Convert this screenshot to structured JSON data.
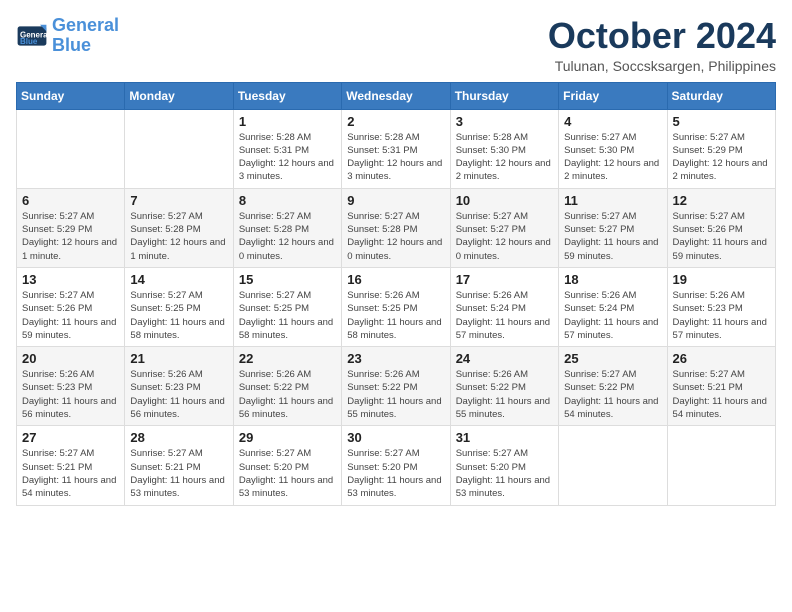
{
  "logo": {
    "line1": "General",
    "line2": "Blue"
  },
  "title": "October 2024",
  "location": "Tulunan, Soccsksargen, Philippines",
  "weekdays": [
    "Sunday",
    "Monday",
    "Tuesday",
    "Wednesday",
    "Thursday",
    "Friday",
    "Saturday"
  ],
  "weeks": [
    [
      null,
      null,
      {
        "day": 1,
        "sunrise": "5:28 AM",
        "sunset": "5:31 PM",
        "daylight": "12 hours and 3 minutes."
      },
      {
        "day": 2,
        "sunrise": "5:28 AM",
        "sunset": "5:31 PM",
        "daylight": "12 hours and 3 minutes."
      },
      {
        "day": 3,
        "sunrise": "5:28 AM",
        "sunset": "5:30 PM",
        "daylight": "12 hours and 2 minutes."
      },
      {
        "day": 4,
        "sunrise": "5:27 AM",
        "sunset": "5:30 PM",
        "daylight": "12 hours and 2 minutes."
      },
      {
        "day": 5,
        "sunrise": "5:27 AM",
        "sunset": "5:29 PM",
        "daylight": "12 hours and 2 minutes."
      }
    ],
    [
      {
        "day": 6,
        "sunrise": "5:27 AM",
        "sunset": "5:29 PM",
        "daylight": "12 hours and 1 minute."
      },
      {
        "day": 7,
        "sunrise": "5:27 AM",
        "sunset": "5:28 PM",
        "daylight": "12 hours and 1 minute."
      },
      {
        "day": 8,
        "sunrise": "5:27 AM",
        "sunset": "5:28 PM",
        "daylight": "12 hours and 0 minutes."
      },
      {
        "day": 9,
        "sunrise": "5:27 AM",
        "sunset": "5:28 PM",
        "daylight": "12 hours and 0 minutes."
      },
      {
        "day": 10,
        "sunrise": "5:27 AM",
        "sunset": "5:27 PM",
        "daylight": "12 hours and 0 minutes."
      },
      {
        "day": 11,
        "sunrise": "5:27 AM",
        "sunset": "5:27 PM",
        "daylight": "11 hours and 59 minutes."
      },
      {
        "day": 12,
        "sunrise": "5:27 AM",
        "sunset": "5:26 PM",
        "daylight": "11 hours and 59 minutes."
      }
    ],
    [
      {
        "day": 13,
        "sunrise": "5:27 AM",
        "sunset": "5:26 PM",
        "daylight": "11 hours and 59 minutes."
      },
      {
        "day": 14,
        "sunrise": "5:27 AM",
        "sunset": "5:25 PM",
        "daylight": "11 hours and 58 minutes."
      },
      {
        "day": 15,
        "sunrise": "5:27 AM",
        "sunset": "5:25 PM",
        "daylight": "11 hours and 58 minutes."
      },
      {
        "day": 16,
        "sunrise": "5:26 AM",
        "sunset": "5:25 PM",
        "daylight": "11 hours and 58 minutes."
      },
      {
        "day": 17,
        "sunrise": "5:26 AM",
        "sunset": "5:24 PM",
        "daylight": "11 hours and 57 minutes."
      },
      {
        "day": 18,
        "sunrise": "5:26 AM",
        "sunset": "5:24 PM",
        "daylight": "11 hours and 57 minutes."
      },
      {
        "day": 19,
        "sunrise": "5:26 AM",
        "sunset": "5:23 PM",
        "daylight": "11 hours and 57 minutes."
      }
    ],
    [
      {
        "day": 20,
        "sunrise": "5:26 AM",
        "sunset": "5:23 PM",
        "daylight": "11 hours and 56 minutes."
      },
      {
        "day": 21,
        "sunrise": "5:26 AM",
        "sunset": "5:23 PM",
        "daylight": "11 hours and 56 minutes."
      },
      {
        "day": 22,
        "sunrise": "5:26 AM",
        "sunset": "5:22 PM",
        "daylight": "11 hours and 56 minutes."
      },
      {
        "day": 23,
        "sunrise": "5:26 AM",
        "sunset": "5:22 PM",
        "daylight": "11 hours and 55 minutes."
      },
      {
        "day": 24,
        "sunrise": "5:26 AM",
        "sunset": "5:22 PM",
        "daylight": "11 hours and 55 minutes."
      },
      {
        "day": 25,
        "sunrise": "5:27 AM",
        "sunset": "5:22 PM",
        "daylight": "11 hours and 54 minutes."
      },
      {
        "day": 26,
        "sunrise": "5:27 AM",
        "sunset": "5:21 PM",
        "daylight": "11 hours and 54 minutes."
      }
    ],
    [
      {
        "day": 27,
        "sunrise": "5:27 AM",
        "sunset": "5:21 PM",
        "daylight": "11 hours and 54 minutes."
      },
      {
        "day": 28,
        "sunrise": "5:27 AM",
        "sunset": "5:21 PM",
        "daylight": "11 hours and 53 minutes."
      },
      {
        "day": 29,
        "sunrise": "5:27 AM",
        "sunset": "5:20 PM",
        "daylight": "11 hours and 53 minutes."
      },
      {
        "day": 30,
        "sunrise": "5:27 AM",
        "sunset": "5:20 PM",
        "daylight": "11 hours and 53 minutes."
      },
      {
        "day": 31,
        "sunrise": "5:27 AM",
        "sunset": "5:20 PM",
        "daylight": "11 hours and 53 minutes."
      },
      null,
      null
    ]
  ]
}
